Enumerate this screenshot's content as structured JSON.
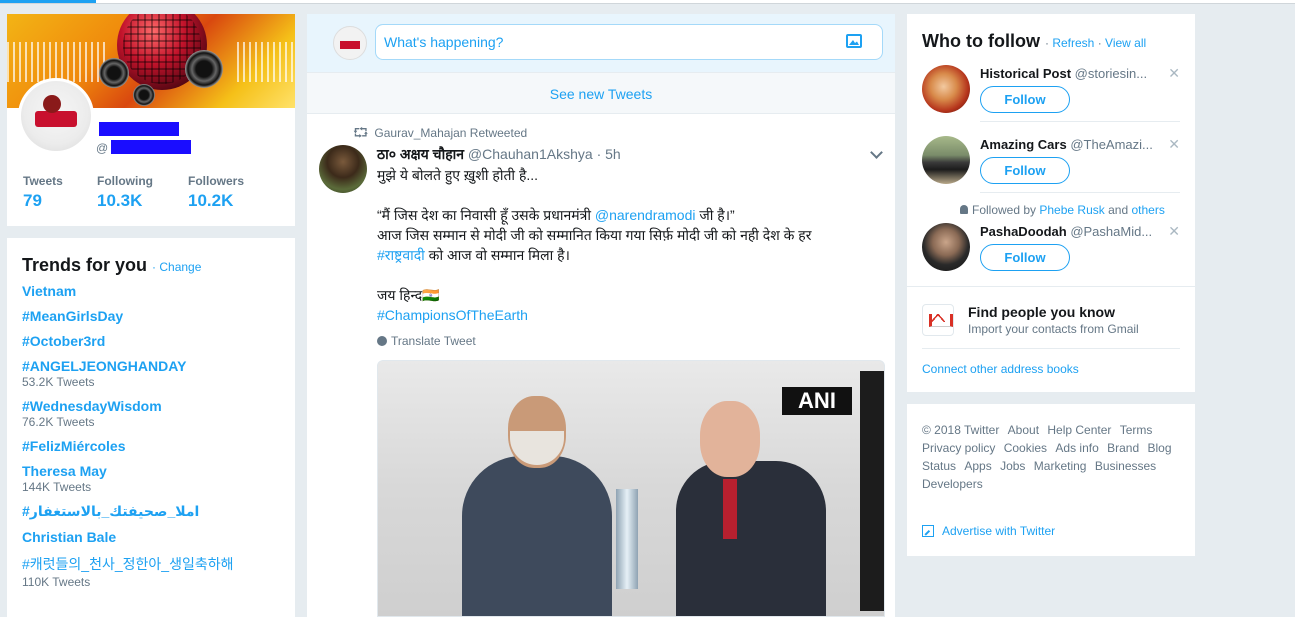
{
  "profile": {
    "handle_prefix": "@",
    "stats": [
      {
        "label": "Tweets",
        "value": "79"
      },
      {
        "label": "Following",
        "value": "10.3K"
      },
      {
        "label": "Followers",
        "value": "10.2K"
      }
    ]
  },
  "trends": {
    "title": "Trends for you",
    "change_label": "· Change",
    "items": [
      {
        "name": "Vietnam",
        "count": ""
      },
      {
        "name": "#MeanGirlsDay",
        "count": ""
      },
      {
        "name": "#October3rd",
        "count": ""
      },
      {
        "name": "#ANGELJEONGHANDAY",
        "count": "53.2K Tweets"
      },
      {
        "name": "#WednesdayWisdom",
        "count": "76.2K Tweets"
      },
      {
        "name": "#FelizMiércoles",
        "count": ""
      },
      {
        "name": "Theresa May",
        "count": "144K Tweets"
      },
      {
        "name": "#املا_صحيفتك_بالاستغفار",
        "count": ""
      },
      {
        "name": "Christian Bale",
        "count": ""
      },
      {
        "name": "#캐럿들의_천사_정한아_생일축하해",
        "count": "110K Tweets"
      }
    ]
  },
  "composer": {
    "placeholder": "What's happening?"
  },
  "timeline": {
    "see_new": "See new Tweets"
  },
  "tweet": {
    "retweeted_by": "Gaurav_Mahajan Retweeted",
    "author_name": "ठा० अक्षय चौहान",
    "author_handle": "@Chauhan1Akshya",
    "time": "· 5h",
    "line1": "मुझे ये बोलते हुए ख़ुशी होती है...",
    "line2_pre": "“मैं जिस देश का निवासी हूँ उसके प्रधानमंत्री ",
    "line2_mention": "@narendramodi",
    "line2_post": " जी है।”",
    "line3": "आज जिस सम्मान से मोदी जी को सम्मानित किया गया सिर्फ़ मोदी जी को नही देश के हर",
    "line4_tag": "#राष्ट्रवादी",
    "line4_post": " को आज वो सम्मान मिला है।",
    "line5": "जय हिन्द🇮🇳",
    "hashtag": "#ChampionsOfTheEarth",
    "translate": "Translate Tweet",
    "photo_watermark": "ANI"
  },
  "who_to_follow": {
    "title": "Who to follow",
    "refresh": "Refresh",
    "view_all": "View all",
    "follow_label": "Follow",
    "social_prefix": "Followed by",
    "social_user": "Phebe Rusk",
    "social_and": "and",
    "social_others": "others",
    "accounts": [
      {
        "name": "Historical Post",
        "handle": "@storiesin..."
      },
      {
        "name": "Amazing Cars",
        "handle": "@TheAmazi..."
      },
      {
        "name": "PashaDoodah",
        "handle": "@PashaMid..."
      }
    ],
    "find_title": "Find people you know",
    "find_sub": "Import your contacts from Gmail",
    "connect": "Connect other address books"
  },
  "footer": {
    "links": [
      "© 2018 Twitter",
      "About",
      "Help Center",
      "Terms",
      "Privacy policy",
      "Cookies",
      "Ads info",
      "Brand",
      "Blog",
      "Status",
      "Apps",
      "Jobs",
      "Marketing",
      "Businesses",
      "Developers"
    ],
    "advertise": "Advertise with Twitter"
  },
  "colors": {
    "accent": "#1da1f2",
    "background": "#e6ecf0",
    "muted": "#657786"
  }
}
